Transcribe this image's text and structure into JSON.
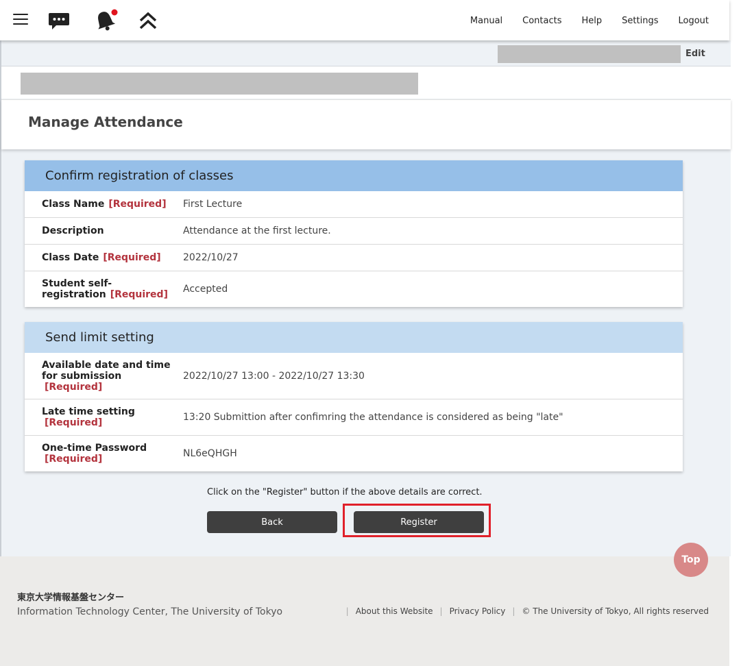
{
  "nav": {
    "items": [
      "Manual",
      "Contacts",
      "Help",
      "Settings",
      "Logout"
    ]
  },
  "header": {
    "edit_label": "Edit",
    "page_title": "Manage Attendance"
  },
  "class_section": {
    "title": "Confirm registration of classes",
    "required_tag": "[Required]",
    "rows": [
      {
        "label": "Class Name",
        "value": "First Lecture"
      },
      {
        "label": "Description",
        "value": "Attendance at the first lecture."
      },
      {
        "label": "Class Date",
        "value": "2022/10/27"
      },
      {
        "label": "Student self-registration",
        "value": "Accepted"
      }
    ]
  },
  "limit_section": {
    "title": "Send limit setting",
    "rows": [
      {
        "label": "Available date and time for submission",
        "value": "2022/10/27 13:00 - 2022/10/27 13:30"
      },
      {
        "label": "Late time setting",
        "value": "13:20 Submittion after confimring the attendance is considered as being \"late\""
      },
      {
        "label": "One-time Password",
        "value": "NL6eQHGH"
      }
    ]
  },
  "actions": {
    "confirm_message": "Click on the \"Register\" button if the above details are correct.",
    "back_label": "Back",
    "register_label": "Register",
    "top_label": "Top"
  },
  "footer": {
    "org_jp": "東京大学情報基盤センター",
    "org_en": "Information Technology Center, The University of Tokyo",
    "links": [
      "About this Website",
      "Privacy Policy"
    ],
    "copyright": "© The University of Tokyo, All rights reserved"
  },
  "colors": {
    "accent_header": "#96bfe8",
    "accent_header_light": "#c3dbf1",
    "required": "#b3333d",
    "highlight_box": "#e0202a"
  }
}
